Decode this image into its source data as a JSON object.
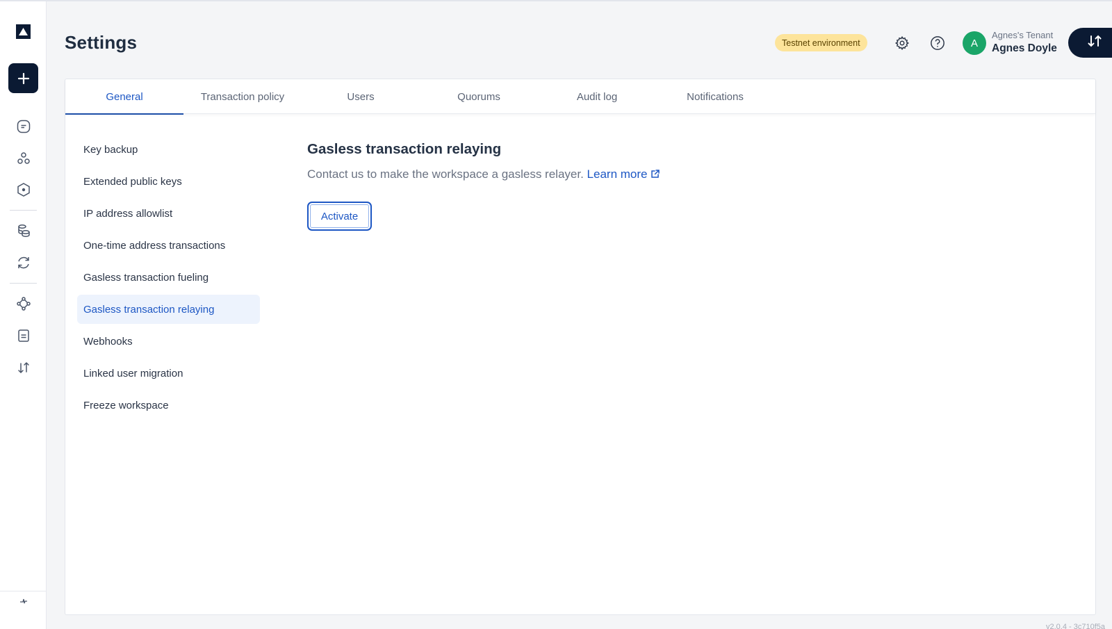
{
  "page": {
    "title": "Settings"
  },
  "header": {
    "environment_badge": "Testnet environment",
    "tenant_name": "Agnes's Tenant",
    "user_name": "Agnes Doyle",
    "avatar_initial": "A"
  },
  "tabs": [
    {
      "label": "General",
      "active": true
    },
    {
      "label": "Transaction policy",
      "active": false
    },
    {
      "label": "Users",
      "active": false
    },
    {
      "label": "Quorums",
      "active": false
    },
    {
      "label": "Audit log",
      "active": false
    },
    {
      "label": "Notifications",
      "active": false
    }
  ],
  "sidebar": {
    "items": [
      {
        "label": "Key backup"
      },
      {
        "label": "Extended public keys"
      },
      {
        "label": "IP address allowlist"
      },
      {
        "label": "One-time address transactions"
      },
      {
        "label": "Gasless transaction fueling"
      },
      {
        "label": "Gasless transaction relaying",
        "active": true
      },
      {
        "label": "Webhooks"
      },
      {
        "label": "Linked user migration"
      },
      {
        "label": "Freeze workspace"
      }
    ]
  },
  "section": {
    "title": "Gasless transaction relaying",
    "description": "Contact us to make the workspace a gasless relayer.",
    "learn_more": "Learn more",
    "activate_label": "Activate"
  },
  "footer": {
    "version": "v2.0.4 - 3c710f5a"
  },
  "colors": {
    "accent": "#1d57c4",
    "navy": "#0b1a33",
    "badge": "#fde49b",
    "avatar": "#1aa568"
  },
  "icons": {
    "rail": [
      "logo-icon",
      "plus-icon",
      "transactions-icon",
      "accounts-icon",
      "assets-icon",
      "wallets-icon",
      "sync-icon",
      "policy-icon",
      "ledger-icon",
      "transfer-icon",
      "collapse-icon"
    ],
    "header": [
      "gear-icon",
      "help-icon",
      "transfer-icon"
    ]
  }
}
